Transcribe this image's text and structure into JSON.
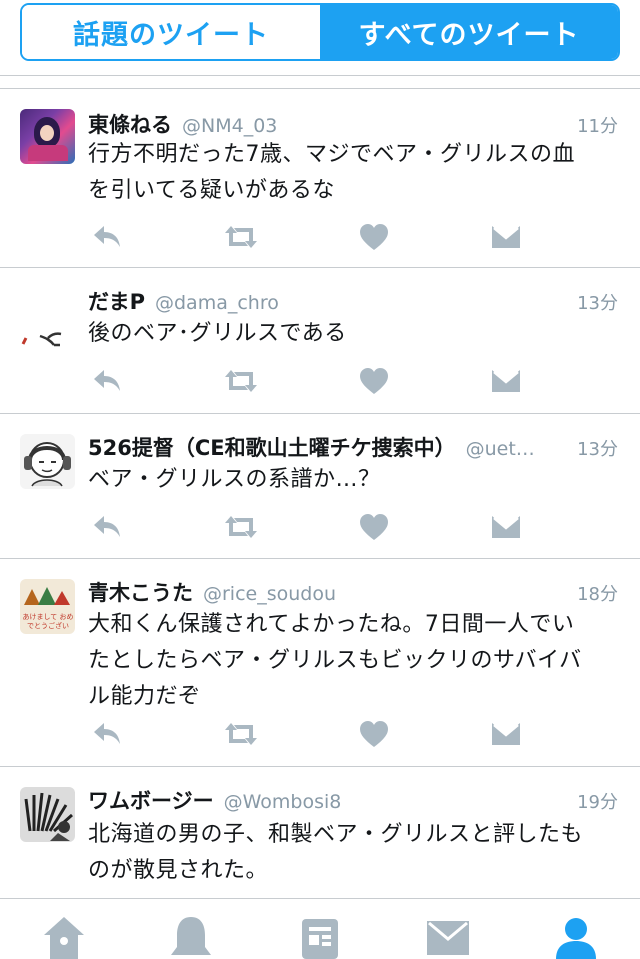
{
  "segments": {
    "trending": "話題のツイート",
    "all": "すべてのツイート"
  },
  "tweets": [
    {
      "name": "東條ねる",
      "handle": "@NM4_03",
      "time": "11分",
      "lines": [
        "行方不明だった7歳、マジでベア・グリルスの血",
        "を引いてる疑いがあるな"
      ]
    },
    {
      "name": "だまP",
      "handle": "@dama_chro",
      "time": "13分",
      "lines": [
        "後のベア･グリルスである"
      ]
    },
    {
      "name": "526提督（CE和歌山土曜チケ捜索中）",
      "handle": "@uet…",
      "time": "13分",
      "lines": [
        "ベア・グリルスの系譜か…？"
      ]
    },
    {
      "name": "青木こうた",
      "handle": "@rice_soudou",
      "time": "18分",
      "lines": [
        "大和くん保護されてよかったね。7日間一人でい",
        "たとしたらベア・グリルスもビックリのサバイバ",
        "ル能力だぞ"
      ],
      "avatar_text": "あけまして おめでとうござい"
    },
    {
      "name": "ワムボージー",
      "handle": "@Wombosi8",
      "time": "19分",
      "lines": [
        "北海道の男の子、和製ベア・グリルスと評したも",
        "のが散見された。"
      ]
    }
  ],
  "tabbar": [
    "home-icon",
    "notifications-icon",
    "moments-icon",
    "messages-icon",
    "profile-icon"
  ],
  "colors": {
    "accent": "#1da1f2",
    "icon_gray": "#aab8c2",
    "meta_gray": "#8899a6"
  }
}
